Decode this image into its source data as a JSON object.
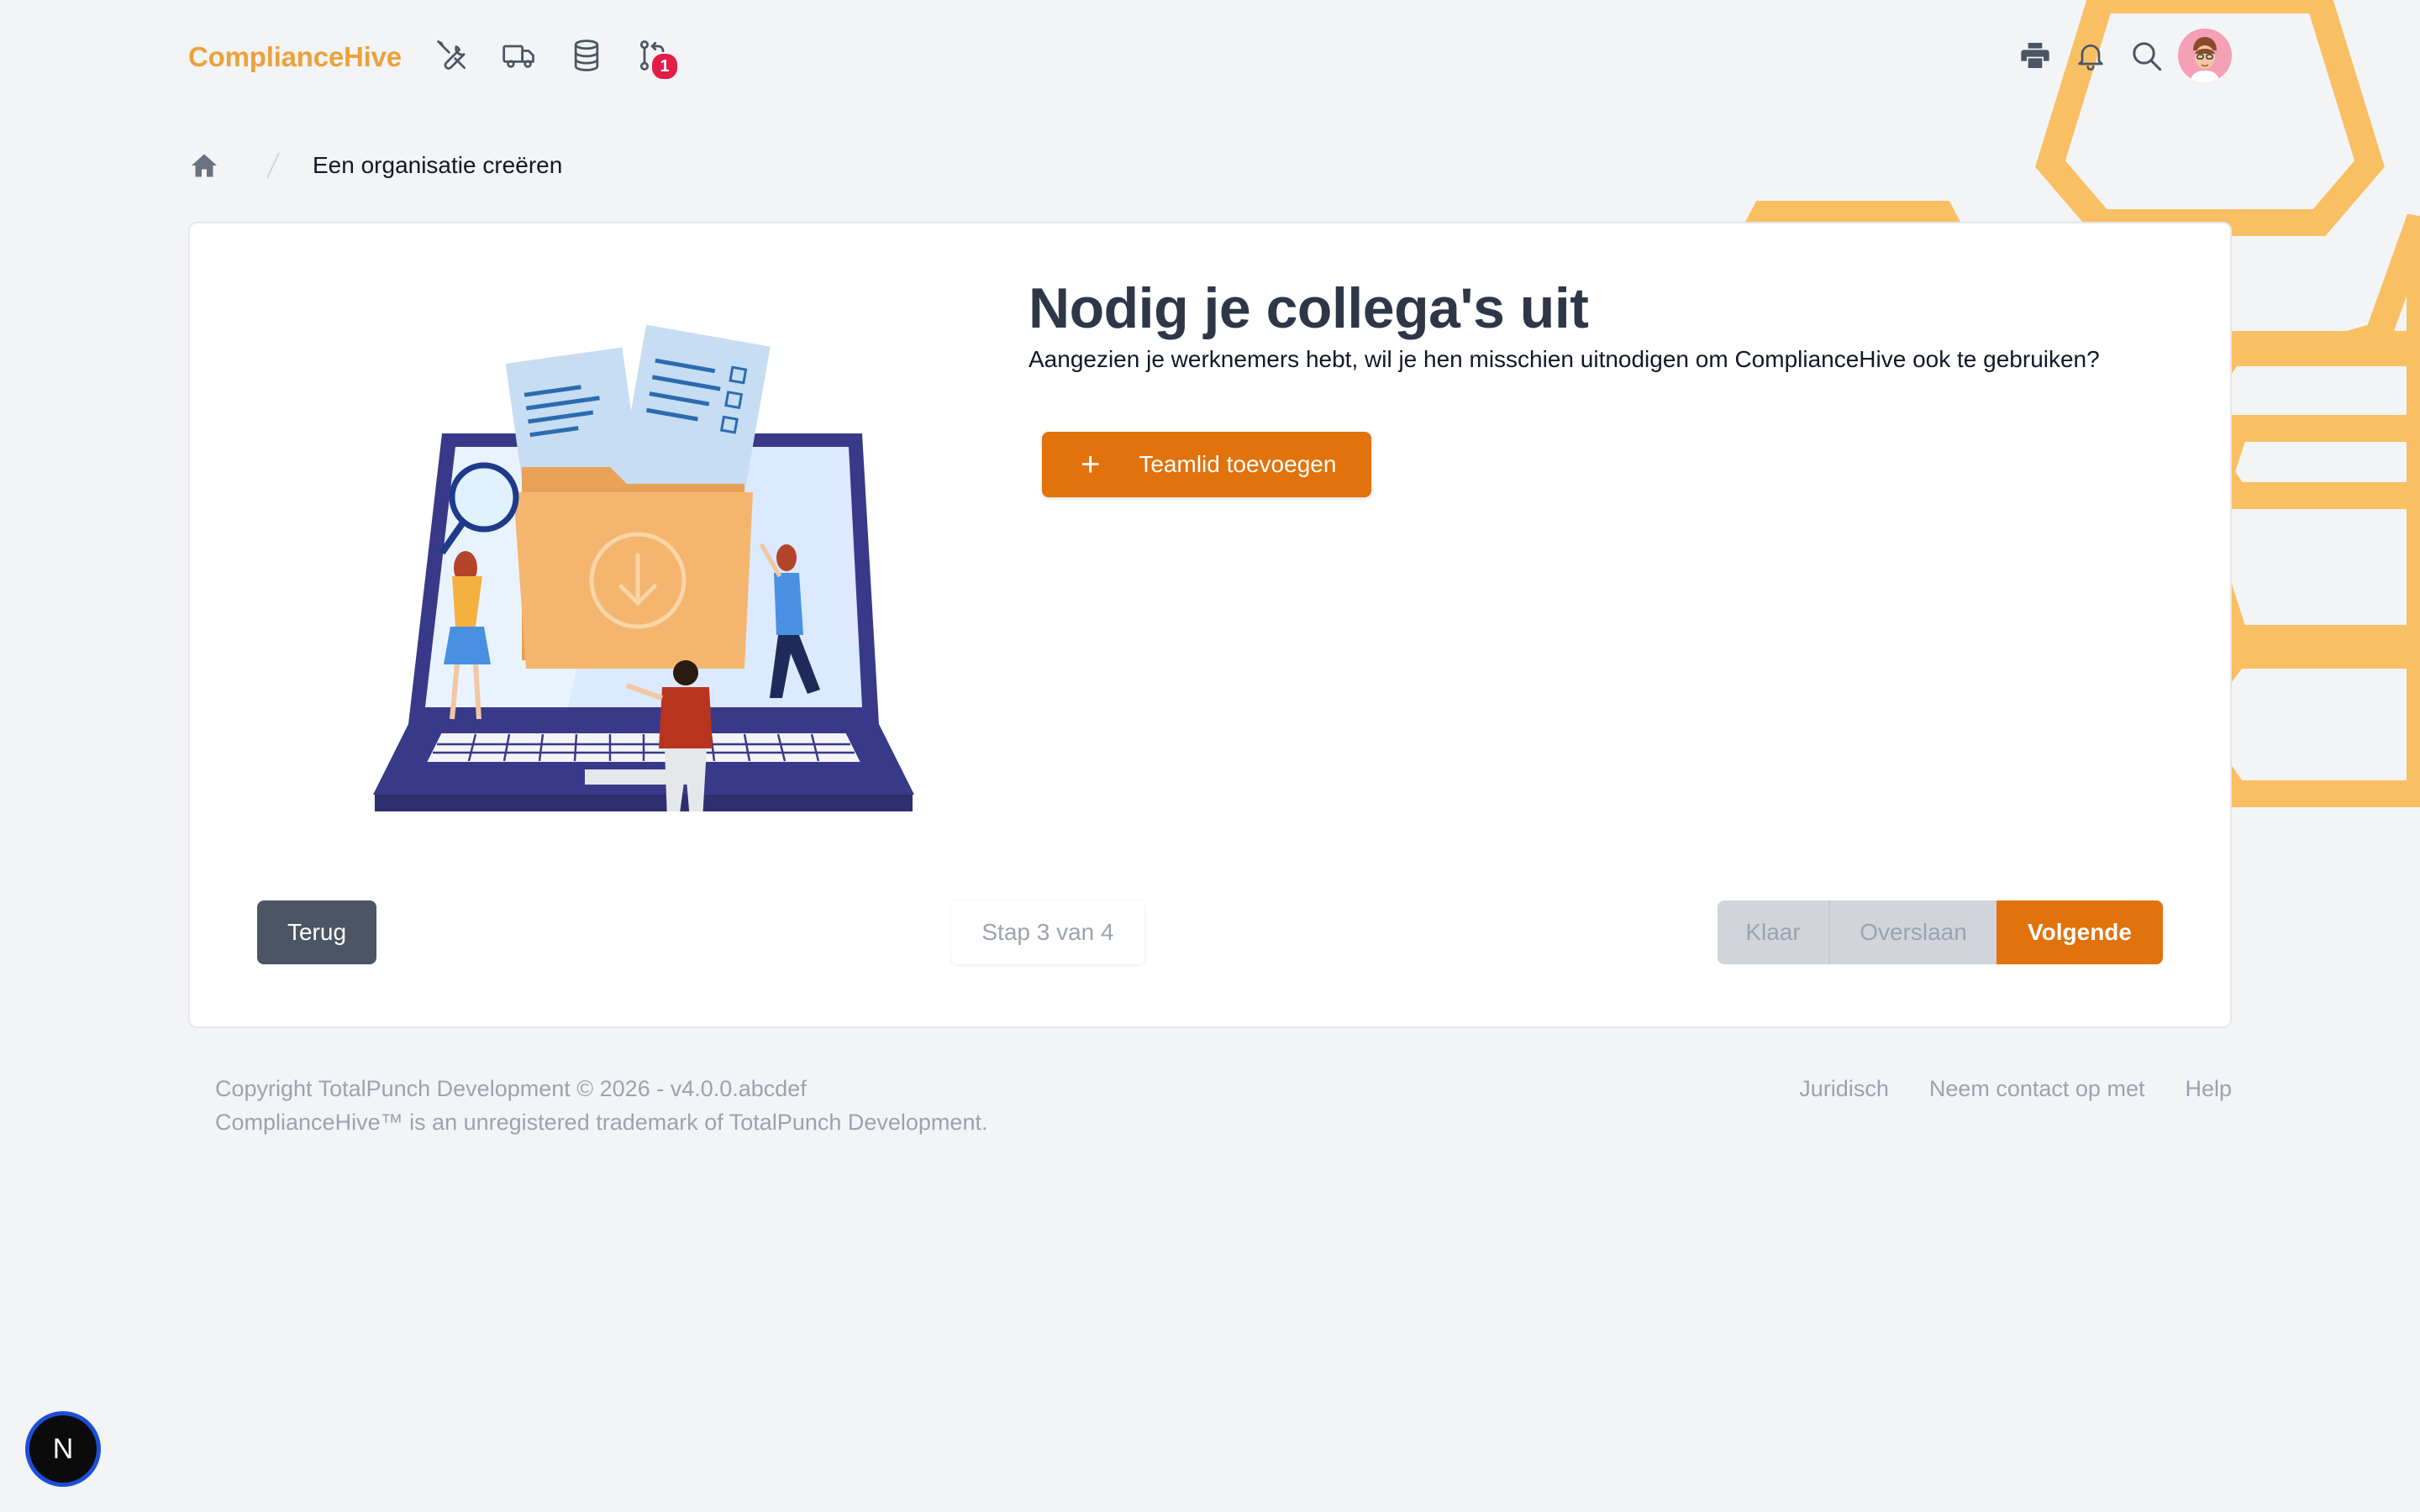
{
  "app": {
    "logo_text": "ComplianceHive"
  },
  "header": {
    "nav_icons": [
      "tools-icon",
      "truck-icon",
      "database-icon",
      "git-pull-request-icon"
    ],
    "notification_count": "1",
    "right_icons": [
      "printer-icon",
      "bell-icon",
      "search-icon"
    ]
  },
  "breadcrumb": {
    "current": "Een organisatie creëren"
  },
  "main": {
    "title": "Nodig je collega's uit",
    "subtitle": "Aangezien je werknemers hebt, wil je hen misschien uitnodigen om ComplianceHive ook te gebruiken?",
    "add_button_label": "Teamlid toevoegen",
    "back_label": "Terug",
    "step_label": "Stap 3 van 4",
    "done_label": "Klaar",
    "skip_label": "Overslaan",
    "next_label": "Volgende"
  },
  "footer": {
    "copyright": "Copyright TotalPunch Development © 2026 - v4.0.0.abcdef",
    "trademark": "ComplianceHive™ is an unregistered trademark of TotalPunch Development.",
    "links": [
      "Juridisch",
      "Neem contact op met",
      "Help"
    ]
  },
  "dev_badge": {
    "letter": "N"
  },
  "colors": {
    "brand": "#e2720c",
    "logo": "#eda13b",
    "hex": "#f9bf63",
    "dark_button": "#4b5563"
  }
}
